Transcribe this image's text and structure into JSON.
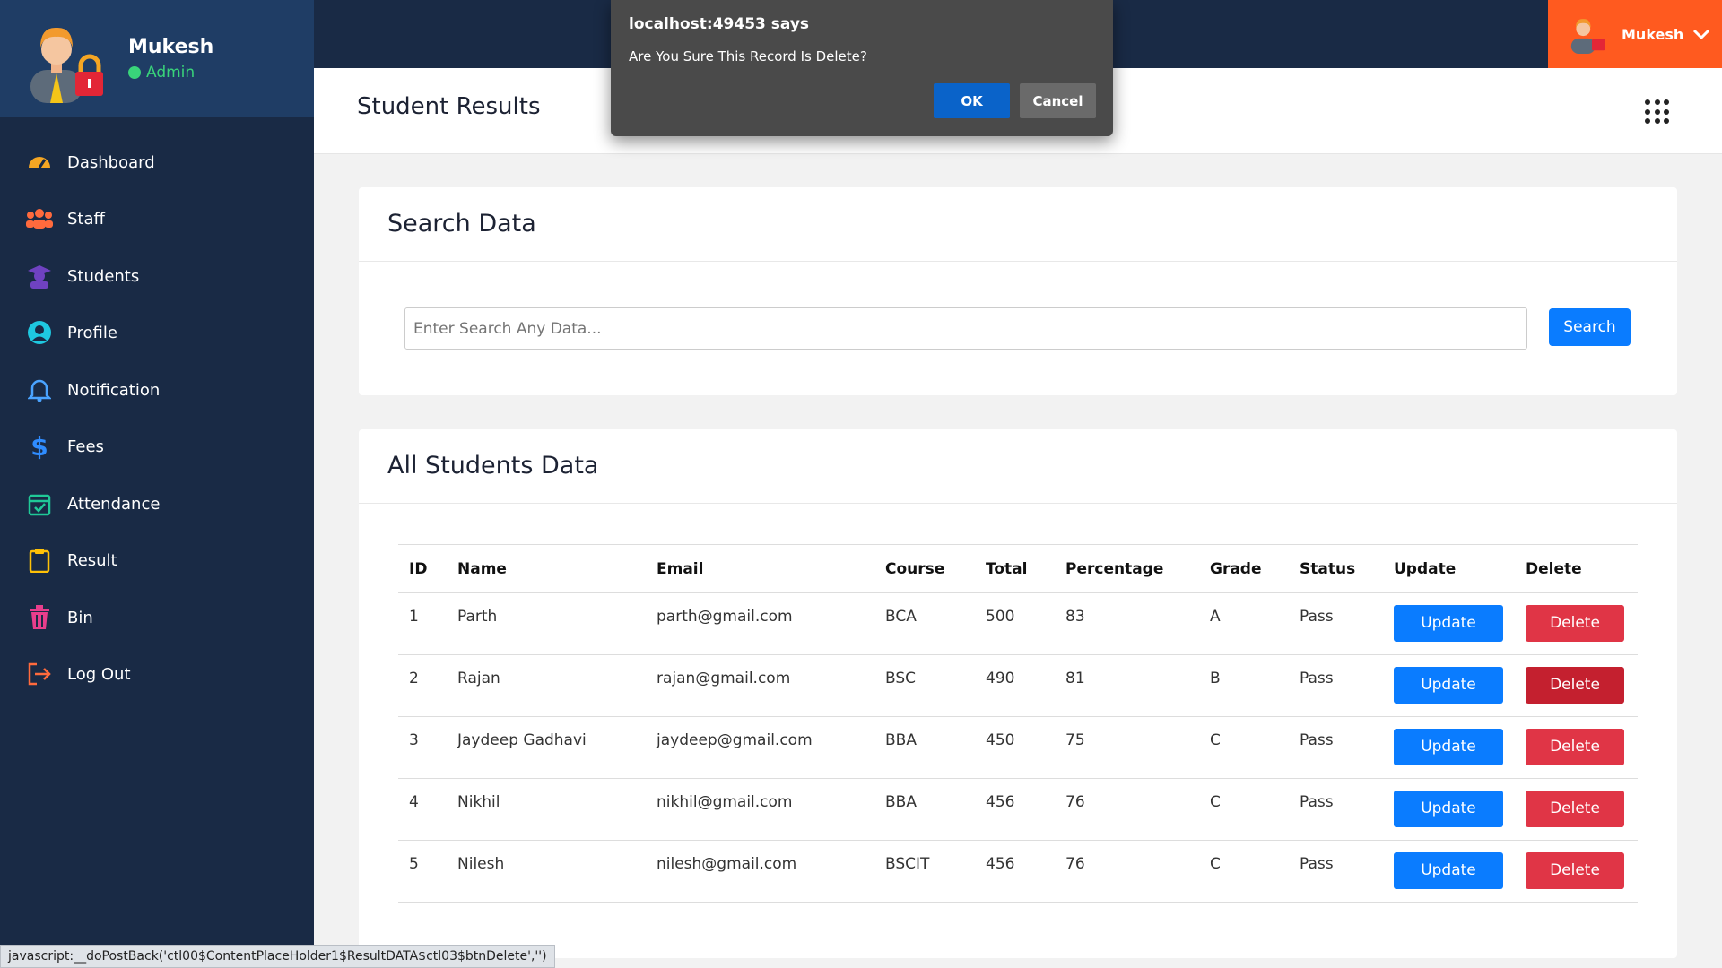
{
  "sidebar": {
    "user": {
      "name": "Mukesh",
      "role": "Admin"
    },
    "items": [
      {
        "label": "Dashboard",
        "icon": "gauge-icon",
        "color": "#f5a623"
      },
      {
        "label": "Staff",
        "icon": "users-icon",
        "color": "#ff6a3d"
      },
      {
        "label": "Students",
        "icon": "graduate-icon",
        "color": "#6f42c1"
      },
      {
        "label": "Profile",
        "icon": "user-circle-icon",
        "color": "#1ec8e0"
      },
      {
        "label": "Notification",
        "icon": "bell-icon",
        "color": "#4aa3ff"
      },
      {
        "label": "Fees",
        "icon": "dollar-icon",
        "color": "#2f8cff"
      },
      {
        "label": "Attendance",
        "icon": "calendar-check-icon",
        "color": "#20c997"
      },
      {
        "label": "Result",
        "icon": "clipboard-icon",
        "color": "#ffc107"
      },
      {
        "label": "Bin",
        "icon": "trash-icon",
        "color": "#e83e8c"
      },
      {
        "label": "Log Out",
        "icon": "logout-icon",
        "color": "#ff6a3d"
      }
    ]
  },
  "topbar": {
    "user_name": "Mukesh"
  },
  "header": {
    "title": "Student Results"
  },
  "search": {
    "title": "Search Data",
    "placeholder": "Enter Search Any Data...",
    "button": "Search"
  },
  "students": {
    "title": "All Students Data",
    "columns": [
      "ID",
      "Name",
      "Email",
      "Course",
      "Total",
      "Percentage",
      "Grade",
      "Status",
      "Update",
      "Delete"
    ],
    "rows": [
      {
        "id": "1",
        "name": "Parth",
        "email": "parth@gmail.com",
        "course": "BCA",
        "total": "500",
        "pct": "83",
        "grade": "A",
        "status": "Pass",
        "update": "Update",
        "delete": "Delete"
      },
      {
        "id": "2",
        "name": "Rajan",
        "email": "rajan@gmail.com",
        "course": "BSC",
        "total": "490",
        "pct": "81",
        "grade": "B",
        "status": "Pass",
        "update": "Update",
        "delete": "Delete"
      },
      {
        "id": "3",
        "name": "Jaydeep Gadhavi",
        "email": "jaydeep@gmail.com",
        "course": "BBA",
        "total": "450",
        "pct": "75",
        "grade": "C",
        "status": "Pass",
        "update": "Update",
        "delete": "Delete"
      },
      {
        "id": "4",
        "name": "Nikhil",
        "email": "nikhil@gmail.com",
        "course": "BBA",
        "total": "456",
        "pct": "76",
        "grade": "C",
        "status": "Pass",
        "update": "Update",
        "delete": "Delete"
      },
      {
        "id": "5",
        "name": "Nilesh",
        "email": "nilesh@gmail.com",
        "course": "BSCIT",
        "total": "456",
        "pct": "76",
        "grade": "C",
        "status": "Pass",
        "update": "Update",
        "delete": "Delete"
      }
    ]
  },
  "dialog": {
    "title": "localhost:49453 says",
    "message": "Are You Sure This Record Is Delete?",
    "ok": "OK",
    "cancel": "Cancel"
  },
  "status_bar": "javascript:__doPostBack('ctl00$ContentPlaceHolder1$ResultDATA$ctl03$btnDelete','')"
}
